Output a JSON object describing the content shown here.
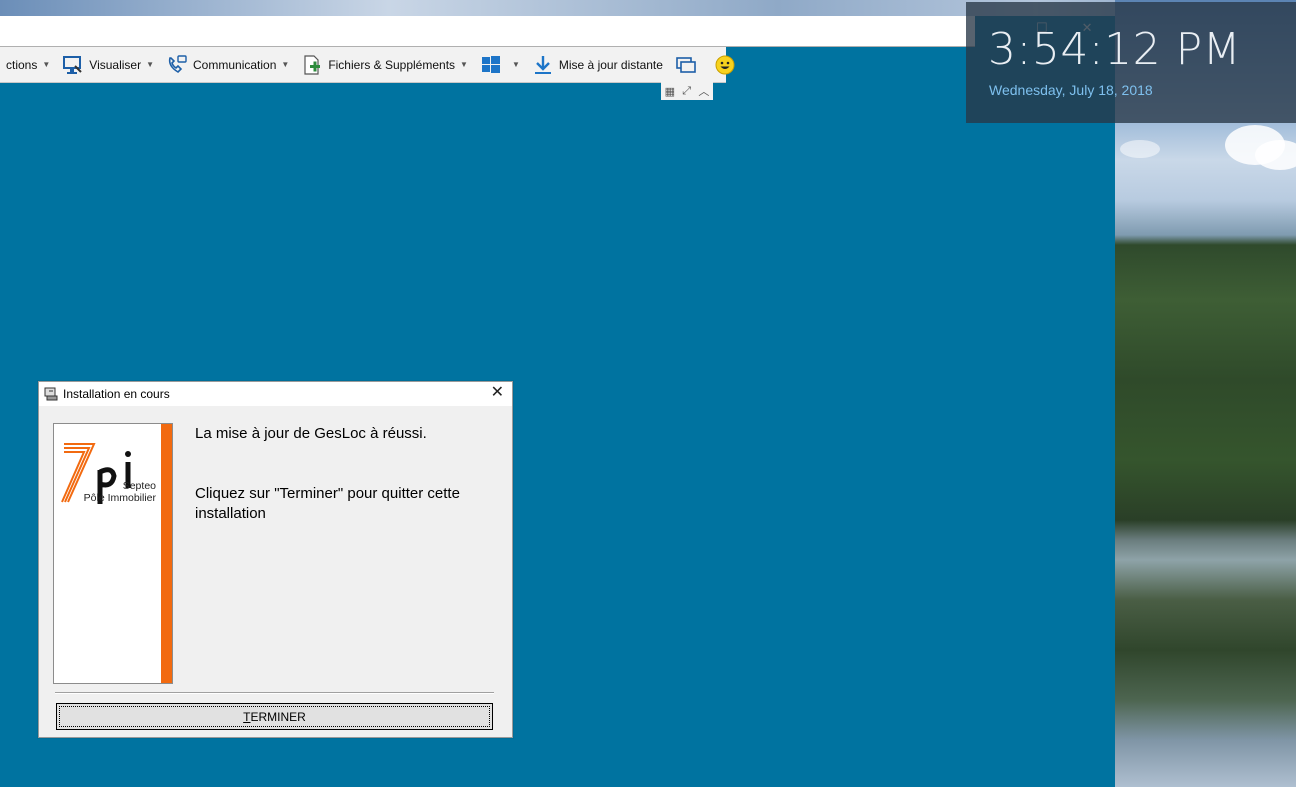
{
  "toolbar": {
    "items": [
      {
        "label": "ctions",
        "icon": "actions-icon"
      },
      {
        "label": "Visualiser",
        "icon": "monitor-icon"
      },
      {
        "label": "Communication",
        "icon": "phone-icon"
      },
      {
        "label": "Fichiers & Suppléments",
        "icon": "file-plus-icon"
      },
      {
        "label": "",
        "icon": "windows-icon"
      },
      {
        "label": "Mise à jour distante",
        "icon": "download-icon"
      }
    ]
  },
  "clock": {
    "time": "3:54:12 PM",
    "date": "Wednesday, July 18, 2018"
  },
  "dialog": {
    "title": "Installation en cours",
    "logo_line1": "Septeo",
    "logo_line2": "Pôle Immobilier",
    "message1": "La mise à jour de GesLoc à réussi.",
    "message2": "Cliquez sur \"Terminer\" pour quitter cette installation",
    "button_label_first": "T",
    "button_label_rest": "ERMINER"
  },
  "colors": {
    "desktop": "#0073a0",
    "logo_accent": "#f26a10",
    "clock_date": "#7ec0ee"
  }
}
